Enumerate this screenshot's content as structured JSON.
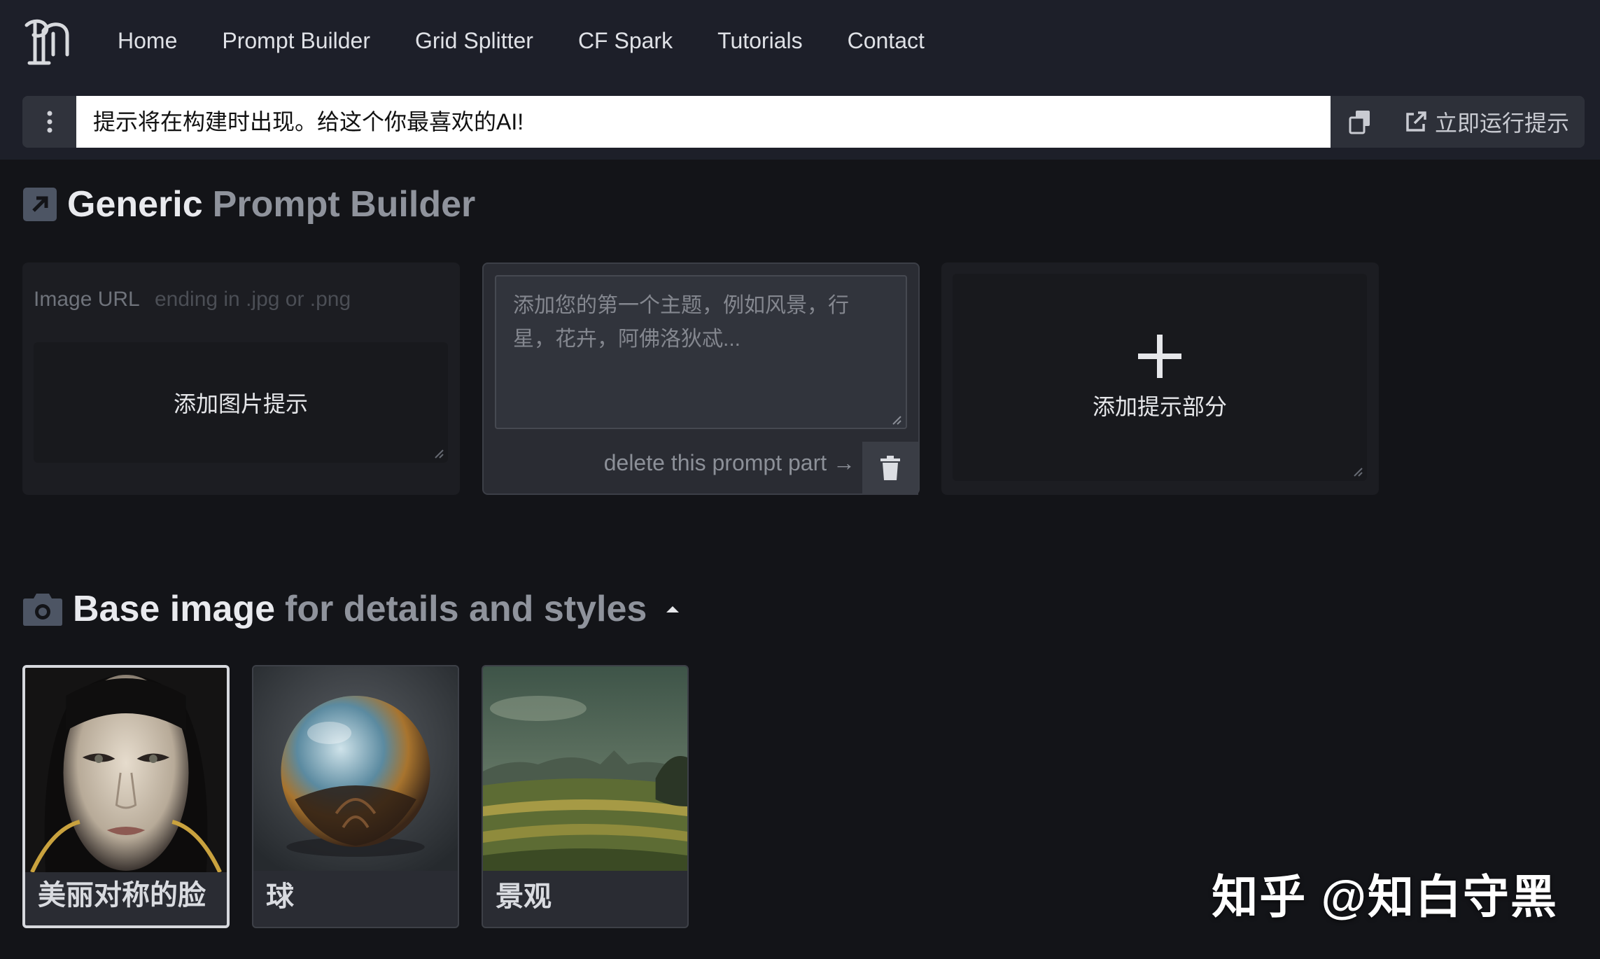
{
  "nav": {
    "items": [
      "Home",
      "Prompt Builder",
      "Grid Splitter",
      "CF Spark",
      "Tutorials",
      "Contact"
    ]
  },
  "prompt_bar": {
    "text": "提示将在构建时出现。给这个你最喜欢的AI!",
    "run_label": "立即运行提示"
  },
  "builder": {
    "title_strong": "Generic",
    "title_muted": "Prompt Builder"
  },
  "image_card": {
    "url_label": "Image URL",
    "url_placeholder": "ending in .jpg or .png",
    "add_label": "添加图片提示"
  },
  "text_card": {
    "placeholder": "添加您的第一个主题，例如风景，行星，花卉，阿佛洛狄忒...",
    "delete_label": "delete this prompt part →"
  },
  "add_card": {
    "label": "添加提示部分"
  },
  "base_image": {
    "title_strong": "Base image",
    "title_muted": "for details and styles",
    "thumbnails": [
      {
        "label": "美丽对称的脸",
        "selected": true
      },
      {
        "label": "球",
        "selected": false
      },
      {
        "label": "景观",
        "selected": false
      }
    ]
  },
  "watermark": "知乎 @知白守黑"
}
